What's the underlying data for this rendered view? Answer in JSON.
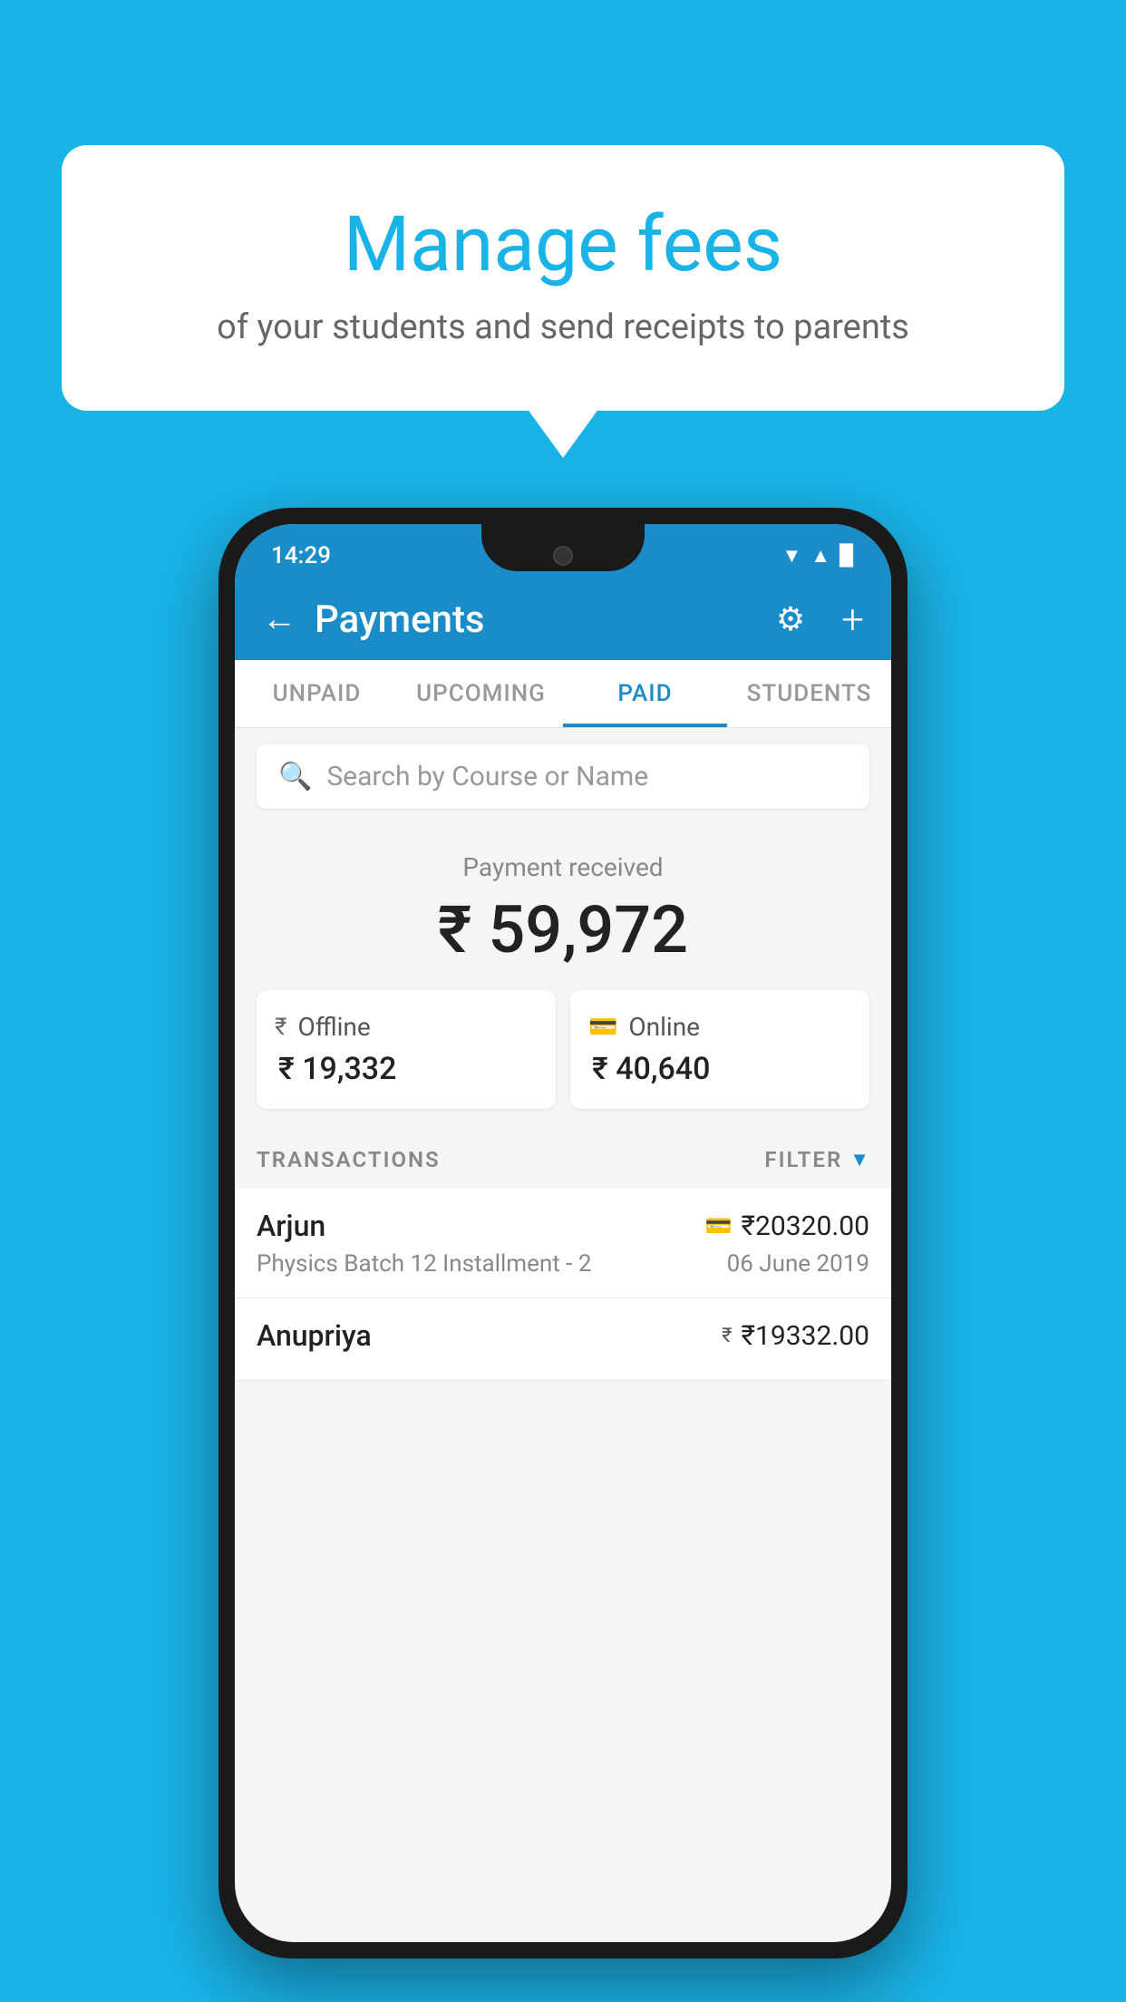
{
  "page": {
    "background_color": "#1ab3e8"
  },
  "bubble": {
    "title": "Manage fees",
    "subtitle": "of your students and send receipts to parents"
  },
  "status_bar": {
    "time": "14:29",
    "wifi": "▲",
    "signal": "▲",
    "battery": "▉"
  },
  "header": {
    "title": "Payments",
    "back_label": "←",
    "plus_label": "+",
    "settings_label": "⚙"
  },
  "tabs": [
    {
      "label": "UNPAID",
      "active": false
    },
    {
      "label": "UPCOMING",
      "active": false
    },
    {
      "label": "PAID",
      "active": true
    },
    {
      "label": "STUDENTS",
      "active": false
    }
  ],
  "search": {
    "placeholder": "Search by Course or Name"
  },
  "payment_summary": {
    "received_label": "Payment received",
    "total_amount": "₹ 59,972",
    "offline_label": "Offline",
    "offline_amount": "₹ 19,332",
    "online_label": "Online",
    "online_amount": "₹ 40,640"
  },
  "transactions": {
    "header_label": "TRANSACTIONS",
    "filter_label": "FILTER",
    "items": [
      {
        "name": "Arjun",
        "amount": "₹20320.00",
        "detail": "Physics Batch 12 Installment - 2",
        "date": "06 June 2019",
        "payment_type": "card"
      },
      {
        "name": "Anupriya",
        "amount": "₹19332.00",
        "detail": "",
        "date": "",
        "payment_type": "rupee"
      }
    ]
  }
}
